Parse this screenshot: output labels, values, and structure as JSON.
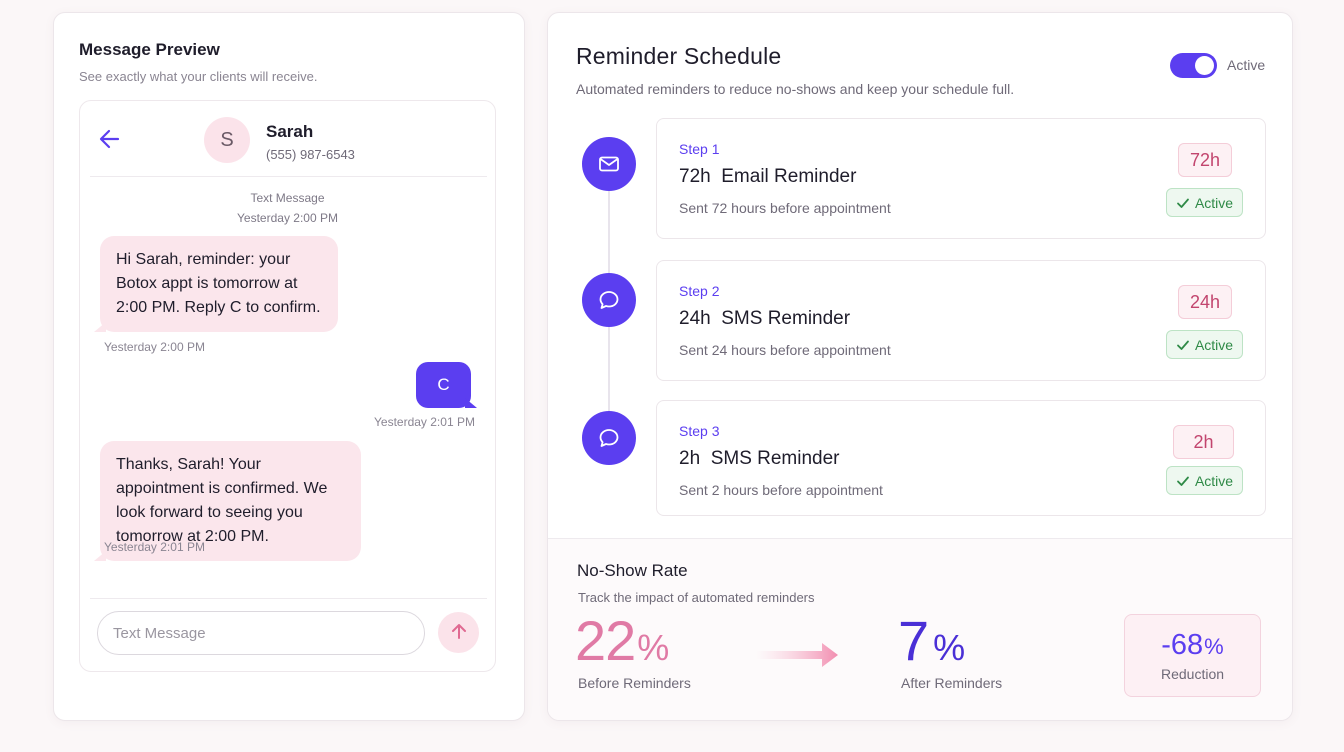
{
  "colors": {
    "accent": "#5b3ef0",
    "pink": "#e07aa5",
    "success": "#2f8a47",
    "background": "#fbf7f8"
  },
  "preview": {
    "title": "Message Preview",
    "subtitle": "See exactly what your clients will receive.",
    "contact": {
      "initial": "S",
      "name": "Sarah",
      "phone": "(555) 987-6543"
    },
    "thread_header": {
      "label": "Text Message",
      "time": "Yesterday 2:00 PM"
    },
    "messages": [
      {
        "direction": "incoming",
        "text": "Hi Sarah, reminder: your Botox appt is tomorrow at 2:00 PM. Reply C to confirm.",
        "time": "Yesterday 2:00 PM"
      },
      {
        "direction": "outgoing",
        "text": "C",
        "time": "Yesterday 2:01 PM"
      },
      {
        "direction": "incoming",
        "text": "Thanks, Sarah! Your appointment is confirmed. We look forward to seeing you tomorrow at 2:00 PM.",
        "time": "Yesterday 2:01 PM"
      }
    ],
    "input_placeholder": "Text Message",
    "icons": {
      "back": "arrow-left-icon",
      "send": "arrow-up-icon"
    }
  },
  "schedule": {
    "title": "Reminder Schedule",
    "subtitle": "Automated reminders to reduce no-shows and keep your schedule full.",
    "toggle": {
      "on": true,
      "label": "Active"
    },
    "steps": [
      {
        "step": "Step 1",
        "name": "72h  Email Reminder",
        "desc": "Sent 72 hours before appointment",
        "time": "72h",
        "status": "Active",
        "icon": "mail-icon"
      },
      {
        "step": "Step 2",
        "name": "24h  SMS Reminder",
        "desc": "Sent 24 hours before appointment",
        "time": "24h",
        "status": "Active",
        "icon": "chat-icon"
      },
      {
        "step": "Step 3",
        "name": "2h  SMS Reminder",
        "desc": "Sent 2 hours before appointment",
        "time": "2h",
        "status": "Active",
        "icon": "chat-icon"
      }
    ]
  },
  "noshow": {
    "title": "No-Show Rate",
    "subtitle": "Track the impact of automated reminders",
    "before": {
      "value": "22",
      "unit": "%",
      "label": "Before Reminders"
    },
    "after": {
      "value": "7",
      "unit": "%",
      "label": "After Reminders"
    },
    "reduction": {
      "value": "-68",
      "unit": "%",
      "label": "Reduction"
    }
  }
}
